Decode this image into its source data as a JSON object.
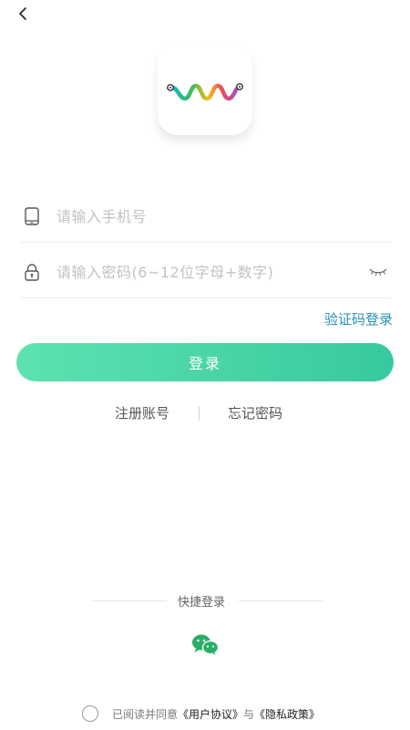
{
  "nav": {
    "back_icon": "chevron-left-icon"
  },
  "logo": {
    "icon": "squiggle-logo-icon"
  },
  "phone_field": {
    "icon": "phone-icon",
    "placeholder": "请输入手机号",
    "value": ""
  },
  "password_field": {
    "icon": "lock-icon",
    "placeholder": "请输入密码(6~12位字母+数字)",
    "value": "",
    "toggle_icon": "eye-closed-icon"
  },
  "sms_login_label": "验证码登录",
  "login_button_label": "登录",
  "register_label": "注册账号",
  "forgot_password_label": "忘记密码",
  "quick_login": {
    "label": "快捷登录",
    "wechat_icon": "wechat-icon"
  },
  "agreement": {
    "prefix": "已阅读并同意",
    "user_agreement": "《用户协议》",
    "conjunction": "与",
    "privacy_policy": "《隐私政策》",
    "checked": false
  },
  "colors": {
    "accent_start": "#5ee2b1",
    "accent_end": "#37c99e",
    "link_blue": "#2a8fb8",
    "wechat_green": "#2aae67"
  }
}
